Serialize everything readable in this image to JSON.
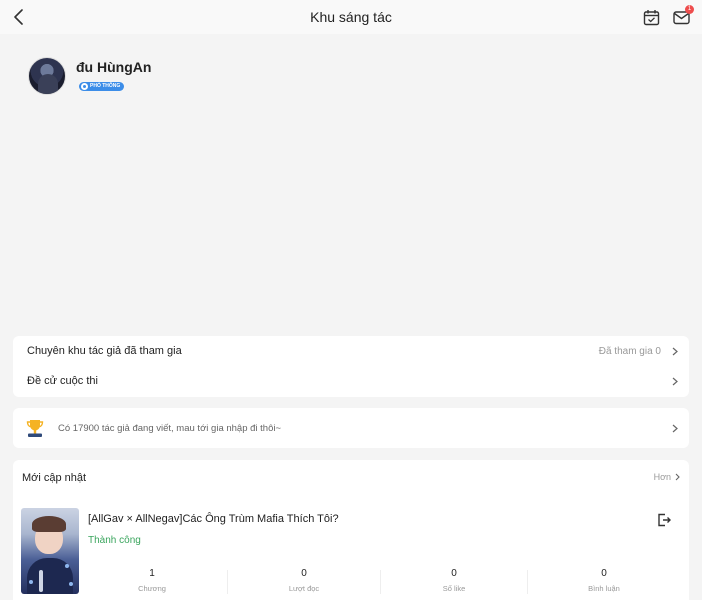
{
  "header": {
    "title": "Khu sáng tác",
    "mail_badge": "1",
    "icons": {
      "back": "chevron-left-icon",
      "calendar": "calendar-check-icon",
      "mail": "mail-icon"
    }
  },
  "profile": {
    "username": "đu HùngAn",
    "level": "PHỔ THÔNG"
  },
  "menu": {
    "joined_label": "Chuyên khu tác giả đã tham gia",
    "joined_value": "Đã tham gia 0",
    "nominate_label": "Đề cử cuộc thi"
  },
  "invite": {
    "text": "Có 17900 tác giả đang viết, mau tới gia nhập đi thôi~",
    "icon": "trophy-icon"
  },
  "recent": {
    "title": "Mới cập nhật",
    "more": "Hơn",
    "book": {
      "title": "[AllGav × AllNegav]Các Ông Trùm Mafia Thích Tôi?",
      "status": "Thành công",
      "stats": [
        {
          "value": "1",
          "label": "Chương"
        },
        {
          "value": "0",
          "label": "Lượt đọc"
        },
        {
          "value": "0",
          "label": "Số like"
        },
        {
          "value": "0",
          "label": "Bình luận"
        }
      ]
    }
  },
  "colors": {
    "accent_blue": "#3c8de8",
    "success_green": "#3aa55d",
    "badge_red": "#ee4d4d",
    "background": "#f4f4f4"
  }
}
